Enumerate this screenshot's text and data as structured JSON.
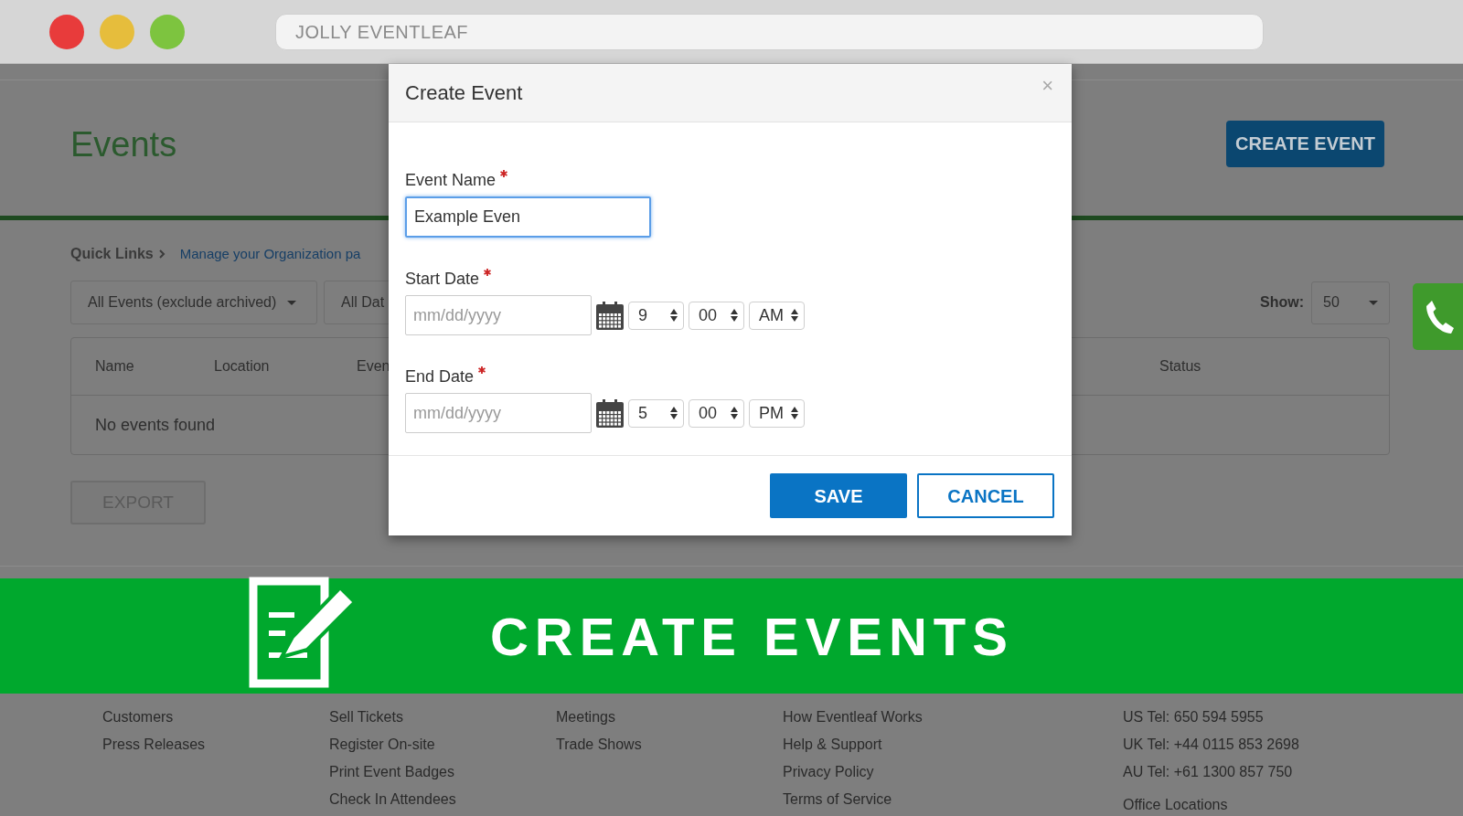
{
  "browser": {
    "title": "JOLLY EVENTLEAF"
  },
  "page": {
    "title": "Events",
    "create_button": "CREATE EVENT",
    "quick_links": {
      "label": "Quick Links",
      "link": "Manage your Organization pa"
    },
    "filters": [
      "All Events (exclude archived)",
      "All Dat"
    ],
    "show": {
      "label": "Show:",
      "value": "50"
    },
    "table": {
      "columns": [
        "Name",
        "Location",
        "Even",
        "Status"
      ],
      "empty": "No events found"
    },
    "export_button": "EXPORT"
  },
  "modal": {
    "title": "Create Event",
    "close": "×",
    "fields": [
      {
        "kind": "text",
        "label": "Event Name",
        "required": true,
        "value": "Example Even",
        "focused": true
      },
      {
        "kind": "datetime",
        "label": "Start Date",
        "required": true,
        "placeholder": "mm/dd/yyyy",
        "hour": "9",
        "minute": "00",
        "period": "AM"
      },
      {
        "kind": "datetime",
        "label": "End Date",
        "required": true,
        "placeholder": "mm/dd/yyyy",
        "hour": "5",
        "minute": "00",
        "period": "PM"
      }
    ],
    "buttons": [
      {
        "label": "SAVE",
        "kind": "primary"
      },
      {
        "label": "CANCEL",
        "kind": "secondary"
      }
    ]
  },
  "banner": {
    "text": "CREATE EVENTS"
  },
  "footer": {
    "columns": [
      [
        "Customers",
        "Press Releases"
      ],
      [
        "Sell Tickets",
        "Register On-site",
        "Print Event Badges",
        "Check In Attendees"
      ],
      [
        "Meetings",
        "Trade Shows"
      ],
      [
        "How Eventleaf Works",
        "Help & Support",
        "Privacy Policy",
        "Terms of Service"
      ],
      [
        "US Tel: 650 594 5955",
        "UK Tel: +44 0115 853 2698",
        "AU Tel: +61 1300 857 750",
        "Office Locations"
      ]
    ]
  }
}
